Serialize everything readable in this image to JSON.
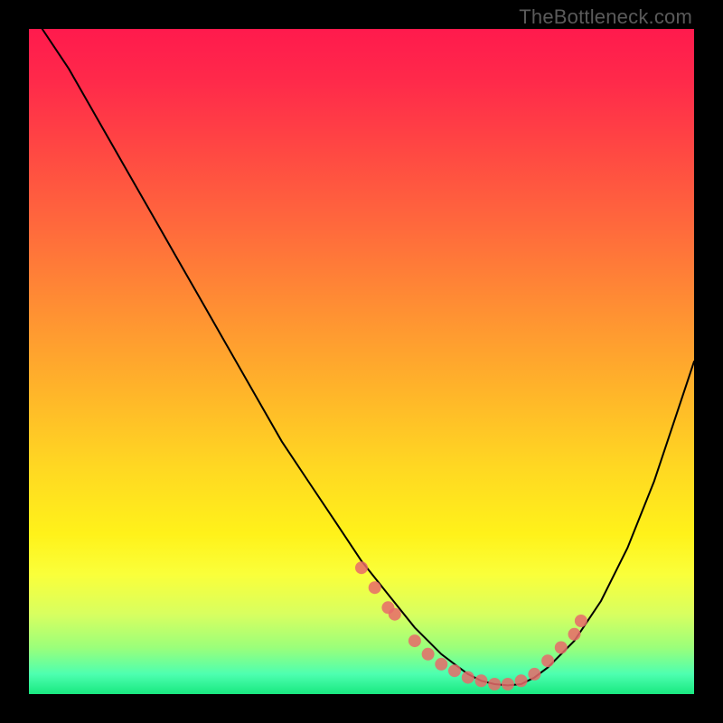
{
  "attribution": "TheBottleneck.com",
  "chart_data": {
    "type": "line",
    "title": "",
    "xlabel": "",
    "ylabel": "",
    "xlim": [
      0,
      100
    ],
    "ylim": [
      0,
      100
    ],
    "series": [
      {
        "name": "curve",
        "x": [
          2,
          6,
          10,
          14,
          18,
          22,
          26,
          30,
          34,
          38,
          42,
          46,
          50,
          54,
          58,
          60,
          62,
          64,
          66,
          68,
          70,
          72,
          74,
          76,
          78,
          82,
          86,
          90,
          94,
          98,
          100
        ],
        "y": [
          100,
          94,
          87,
          80,
          73,
          66,
          59,
          52,
          45,
          38,
          32,
          26,
          20,
          15,
          10,
          8,
          6,
          4.5,
          3,
          2,
          1.5,
          1.3,
          1.5,
          2.5,
          4,
          8,
          14,
          22,
          32,
          44,
          50
        ]
      },
      {
        "name": "markers",
        "x": [
          50,
          52,
          54,
          55,
          58,
          60,
          62,
          64,
          66,
          68,
          70,
          72,
          74,
          76,
          78,
          80,
          82,
          83
        ],
        "y": [
          19,
          16,
          13,
          12,
          8,
          6,
          4.5,
          3.5,
          2.5,
          2,
          1.5,
          1.5,
          2,
          3,
          5,
          7,
          9,
          11
        ]
      }
    ]
  }
}
